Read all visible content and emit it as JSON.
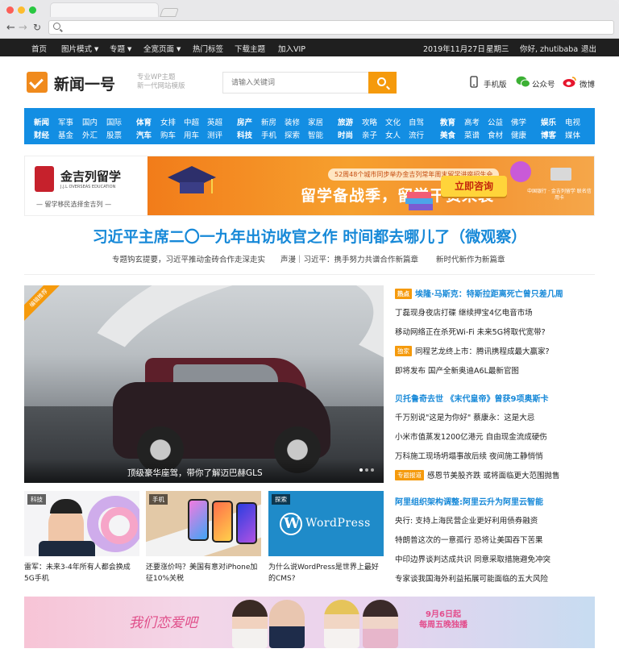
{
  "topbar": {
    "home": "首页",
    "image_mode": "图片模式",
    "topics": "专题",
    "fullwidth": "全宽页面",
    "hot_tags": "热门标签",
    "download": "下载主题",
    "vip": "加入VIP",
    "date": "2019年11月27日",
    "weekday": "星期三",
    "greeting": "你好, zhutibaba",
    "logout": "退出"
  },
  "header": {
    "logo": "新闻一号",
    "slogan_1": "专业WP主题",
    "slogan_2": "新一代网站模版",
    "search_placeholder": "请输入关键词",
    "mobile": "手机版",
    "wechat": "公众号",
    "weibo": "微博"
  },
  "colors": {
    "accent": "#f59a0c",
    "nav": "#138ee3",
    "headline": "#1789d8"
  },
  "catnav": {
    "group1_row1": [
      "新闻",
      "军事",
      "国内",
      "国际"
    ],
    "group1_row2": [
      "财经",
      "基金",
      "外汇",
      "股票"
    ],
    "group2_row1": [
      "体育",
      "女排",
      "中超",
      "英超"
    ],
    "group2_row2": [
      "汽车",
      "购车",
      "用车",
      "测评"
    ],
    "group3_row1": [
      "房产",
      "新房",
      "装修",
      "家居"
    ],
    "group3_row2": [
      "科技",
      "手机",
      "探索",
      "智能"
    ],
    "group4_row1": [
      "旅游",
      "攻略",
      "文化",
      "自驾"
    ],
    "group4_row2": [
      "时尚",
      "亲子",
      "女人",
      "流行"
    ],
    "group5_row1": [
      "教育",
      "高考",
      "公益",
      "佛学"
    ],
    "group5_row2": [
      "美食",
      "菜谱",
      "食材",
      "健康"
    ],
    "group6_row1": [
      "娱乐",
      "电视"
    ],
    "group6_row2": [
      "博客",
      "媒体"
    ]
  },
  "banner": {
    "brand": "金吉列留学",
    "brand_en": "J.J.L OVERSEAS EDUCATION",
    "brand_slogan": "— 留学移民选择金吉列 —",
    "sub": "52周48个城市同步举办金吉列常年周末留学讲座招生会",
    "main": "留学备战季，留学干货来袭",
    "button": "立即咨询",
    "bank": "中国银行 · 金吉列留学 联名信用卡"
  },
  "headline": {
    "title": "习近平主席二〇一九年出访收官之作 时间都去哪儿了（微观察）",
    "sub1": "专题钩玄提要，习近平推动金砖合作走深走实",
    "sub2": "声漫｜习近平：携手努力共谱合作新篇章",
    "sub3": "新时代新作为新篇章"
  },
  "feature": {
    "badge": "编辑推荐",
    "caption": "顶级豪华座驾，带你了解迈巴赫GLS"
  },
  "news": [
    {
      "tag": "热点",
      "text": "埃隆·马斯克：特斯拉距离死亡曾只差几周",
      "style": "blue"
    },
    {
      "tag": "",
      "text": "丁磊现身夜店打碟 继续押宝4亿电音市场",
      "style": ""
    },
    {
      "tag": "",
      "text": "移动网络正在杀死Wi-Fi 未来5G将取代宽带?",
      "style": ""
    },
    {
      "tag": "独家",
      "text": "同程艺龙终上市：腾讯携程成最大赢家?",
      "style": ""
    },
    {
      "tag": "",
      "text": "即将发布 国产全新奥迪A6L最新官图",
      "style": ""
    },
    {
      "tag": "",
      "text": "贝托鲁奇去世 《末代皇帝》曾获9项奥斯卡",
      "style": "blue"
    },
    {
      "tag": "",
      "text": "千万别说\"这是为你好\" 蔡康永：这是大忌",
      "style": ""
    },
    {
      "tag": "",
      "text": "小米市值蒸发1200亿港元 自由现金流成硬伤",
      "style": ""
    },
    {
      "tag": "",
      "text": "万科施工现场坍塌事故后续 夜间施工静悄悄",
      "style": ""
    },
    {
      "tag": "专题报道",
      "text": "感恩节美股齐跌 或将面临更大范围抛售",
      "style": ""
    },
    {
      "tag": "",
      "text": "阿里组织架构调整:阿里云升为阿里云智能",
      "style": "blue"
    },
    {
      "tag": "",
      "text": "央行: 支持上海民营企业更好利用债券融资",
      "style": ""
    },
    {
      "tag": "",
      "text": "特朗普这次的一意孤行 恐将让美国吞下苦果",
      "style": ""
    },
    {
      "tag": "",
      "text": "中印边界谈判达成共识 同意采取措施避免冲突",
      "style": ""
    },
    {
      "tag": "",
      "text": "专家谈我国海外利益拓展可能面临的五大风险",
      "style": ""
    }
  ],
  "cards": [
    {
      "label": "科技",
      "caption": "雷军：未来3-4年所有人都会换成5G手机"
    },
    {
      "label": "手机",
      "caption": "还要涨价吗？美国有意对iPhone加征10%关税"
    },
    {
      "label": "探索",
      "caption": "为什么说WordPress是世界上最好的CMS?",
      "logo": "WordPress"
    }
  ],
  "bottom_banner": {
    "script": "我们恋爱吧",
    "date": "9月6日起",
    "schedule": "每周五晚独播"
  }
}
